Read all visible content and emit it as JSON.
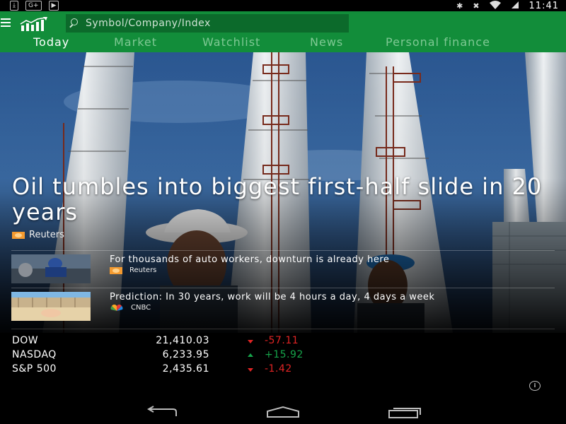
{
  "status_bar": {
    "left_icons": [
      "download-icon",
      "google-plus-icon",
      "youtube-icon"
    ],
    "gplus_label": "G+",
    "right_icons": [
      "bluetooth-icon",
      "mute-icon",
      "wifi-icon",
      "battery-icon"
    ],
    "time": "11:41"
  },
  "header": {
    "search_placeholder": "Symbol/Company/Index",
    "tabs": [
      {
        "label": "Today",
        "active": true
      },
      {
        "label": "Market",
        "active": false
      },
      {
        "label": "Watchlist",
        "active": false
      },
      {
        "label": "News",
        "active": false
      },
      {
        "label": "Personal finance",
        "active": false
      }
    ],
    "accent_color": "#128d3a"
  },
  "hero": {
    "headline": "Oil tumbles into biggest first-half slide in 20 years",
    "source": "Reuters"
  },
  "stories": [
    {
      "title": "For thousands of auto workers, downturn is already here",
      "source": "Reuters"
    },
    {
      "title": "Prediction: In 30 years, work will be 4 hours a day, 4 days a week",
      "source": "CNBC"
    }
  ],
  "ticker": [
    {
      "name": "DOW",
      "value": "21,410.03",
      "change": "-57.11",
      "direction": "down"
    },
    {
      "name": "NASDAQ",
      "value": "6,233.95",
      "change": "+15.92",
      "direction": "up"
    },
    {
      "name": "S&P 500",
      "value": "2,435.61",
      "change": "-1.42",
      "direction": "down"
    }
  ],
  "colors": {
    "down": "#e02424",
    "up": "#16a34a"
  },
  "nav": [
    "back-icon",
    "home-icon",
    "recents-icon"
  ]
}
